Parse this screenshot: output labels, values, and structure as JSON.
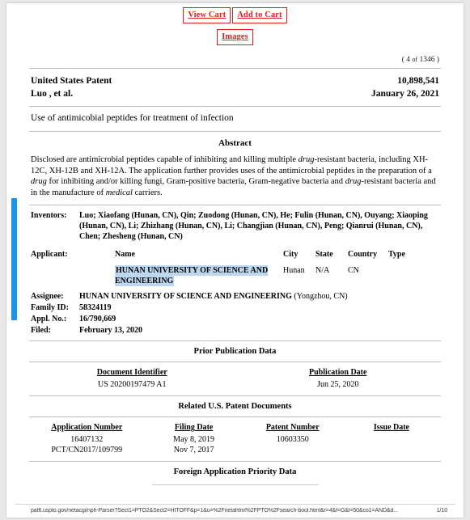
{
  "toolbar": {
    "view_cart_label": "View Cart",
    "add_to_cart_label": "Add to Cart",
    "images_label": "Images"
  },
  "counter": {
    "prefix": "(",
    "current": "4",
    "of": "of",
    "total": "1346",
    "suffix": ")"
  },
  "patent_header": {
    "office": "United States Patent",
    "patent_number": "10,898,541",
    "inventor_line": "Luo ,   et al.",
    "issue_date": "January 26, 2021"
  },
  "title": "Use of antimicobial peptides for treatment of infection",
  "abstract": {
    "heading": "Abstract",
    "text_part_1": "Disclosed are antimicrobial peptides capable of inhibiting and killing multiple ",
    "italic_1": "drug",
    "text_part_2": "-resistant bacteria, including XH-12C, XH-12B and XH-12A. The application further provides uses of the antimicrobial peptides in the preparation of a ",
    "italic_2": "drug",
    "text_part_3": " for inhibiting and/or killing fungi, Gram-positive bacteria, Gram-negative bacteria and ",
    "italic_3": "drug",
    "text_part_4": "-resistant bacteria and in the manufacture of ",
    "italic_4": "medical",
    "text_part_5": " carriers."
  },
  "biblio": {
    "inventors_label": "Inventors:",
    "inventors_value": "Luo; Xiaofang (Hunan, CN), Qin; Zuodong (Hunan, CN), He; Fulin (Hunan, CN), Ouyang; Xiaoping (Hunan, CN), Li; Zhizhang (Hunan, CN), Li; Changjian (Hunan, CN), Peng; Qianrui (Hunan, CN), Chen; Zhesheng (Hunan, CN)",
    "applicant_label": "Applicant:",
    "applicant_columns": {
      "name": "Name",
      "city": "City",
      "state": "State",
      "country": "Country",
      "type": "Type"
    },
    "applicant_row": {
      "name": "HUNAN UNIVERSITY OF SCIENCE AND ENGINEERING",
      "city": "Hunan",
      "state": "N/A",
      "country": "CN",
      "type": ""
    },
    "assignee_label": "Assignee:",
    "assignee_value": "HUNAN UNIVERSITY OF SCIENCE AND ENGINEERING",
    "assignee_paren": "(Yongzhou, CN)",
    "family_id_label": "Family ID:",
    "family_id_value": "58324119",
    "appl_no_label": "Appl. No.:",
    "appl_no_value": "16/790,669",
    "filed_label": "Filed:",
    "filed_value": "February 13, 2020"
  },
  "prior_publication": {
    "heading": "Prior Publication Data",
    "columns": [
      "Document Identifier",
      "Publication Date"
    ],
    "rows": [
      [
        "US 20200197479 A1",
        "Jun 25, 2020"
      ]
    ]
  },
  "related_documents": {
    "heading": "Related U.S. Patent Documents",
    "columns": [
      "Application Number",
      "Filing Date",
      "Patent Number",
      "Issue Date"
    ],
    "rows": [
      [
        "16407132",
        "May 8, 2019",
        "10603350",
        ""
      ],
      [
        "PCT/CN2017/109799",
        "Nov 7, 2017",
        "",
        ""
      ]
    ]
  },
  "foreign_priority": {
    "heading": "Foreign Application Priority Data"
  },
  "footer": {
    "url": "patft.uspto.gov/netacgi/nph-Parser?Sect1=PTO2&Sect2=HITOFF&p=1&u=%2Fnetahtml%2FPTO%2Fsearch-bool.html&r=4&f=G&l=50&co1=AND&d...",
    "page": "1/10"
  },
  "colors": {
    "cart_button": "#e02020",
    "highlight": "#bdd7ee",
    "selection_bar": "#1a93e8"
  }
}
